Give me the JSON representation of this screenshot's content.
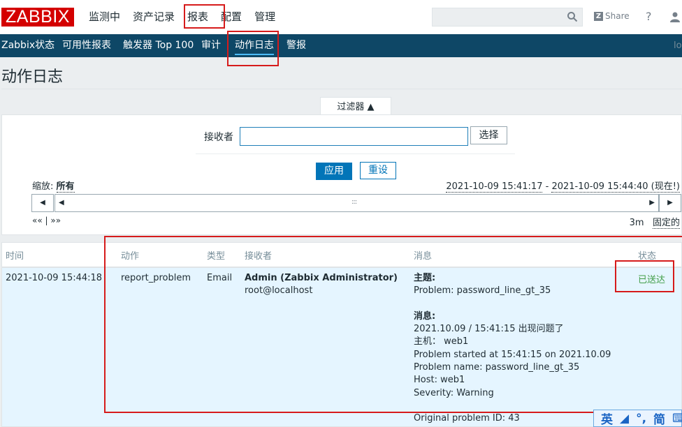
{
  "header": {
    "logo": "ZABBIX",
    "menu": [
      "监测中",
      "资产记录",
      "报表",
      "配置",
      "管理"
    ],
    "share_label": "Share",
    "help_label": "?"
  },
  "submenu": {
    "items": [
      "Zabbix状态",
      "可用性报表",
      "触发器 Top 100",
      "审计",
      "动作日志",
      "警报"
    ],
    "trailing": "lo"
  },
  "page": {
    "title": "动作日志"
  },
  "filter": {
    "tab_label": "过滤器 ▲",
    "recipient_label": "接收者",
    "recipient_value": "",
    "select_label": "选择",
    "apply_label": "应用",
    "reset_label": "重设"
  },
  "timeline": {
    "zoom_label": "缩放:",
    "zoom_value": "所有",
    "from": "2021-10-09 15:41:17",
    "separator": " - ",
    "to": "2021-10-09 15:44:40 (现在!)",
    "step_back": "««",
    "step_sep": " | ",
    "step_fwd": "»»",
    "period": "3m",
    "fixed_label": "固定的",
    "grip": ":::"
  },
  "table": {
    "columns": [
      "时间",
      "动作",
      "类型",
      "接收者",
      "消息",
      "状态"
    ],
    "rows": [
      {
        "time": "2021-10-09 15:44:18",
        "action": "report_problem",
        "type": "Email",
        "recipient_name": "Admin (Zabbix Administrator)",
        "recipient_addr": "root@localhost",
        "subject_label": "主题:",
        "subject": "Problem: password_line_gt_35",
        "message_label": "消息:",
        "message_lines": [
          "2021.10.09 / 15:41:15 出现问题了",
          "主机：  web1",
          "Problem started at 15:41:15 on 2021.10.09",
          "Problem name: password_line_gt_35",
          "Host: web1",
          "Severity: Warning",
          "",
          "Original problem ID: 43"
        ],
        "status": "已送达"
      }
    ]
  },
  "ime": {
    "items": [
      "英",
      "◢",
      "°,",
      "简",
      "⌨"
    ]
  },
  "colors": {
    "brand": "#d40000",
    "navbar": "#0e4766",
    "accent": "#0275b8",
    "status_ok": "#429e47",
    "annotation": "#d61b1b"
  }
}
